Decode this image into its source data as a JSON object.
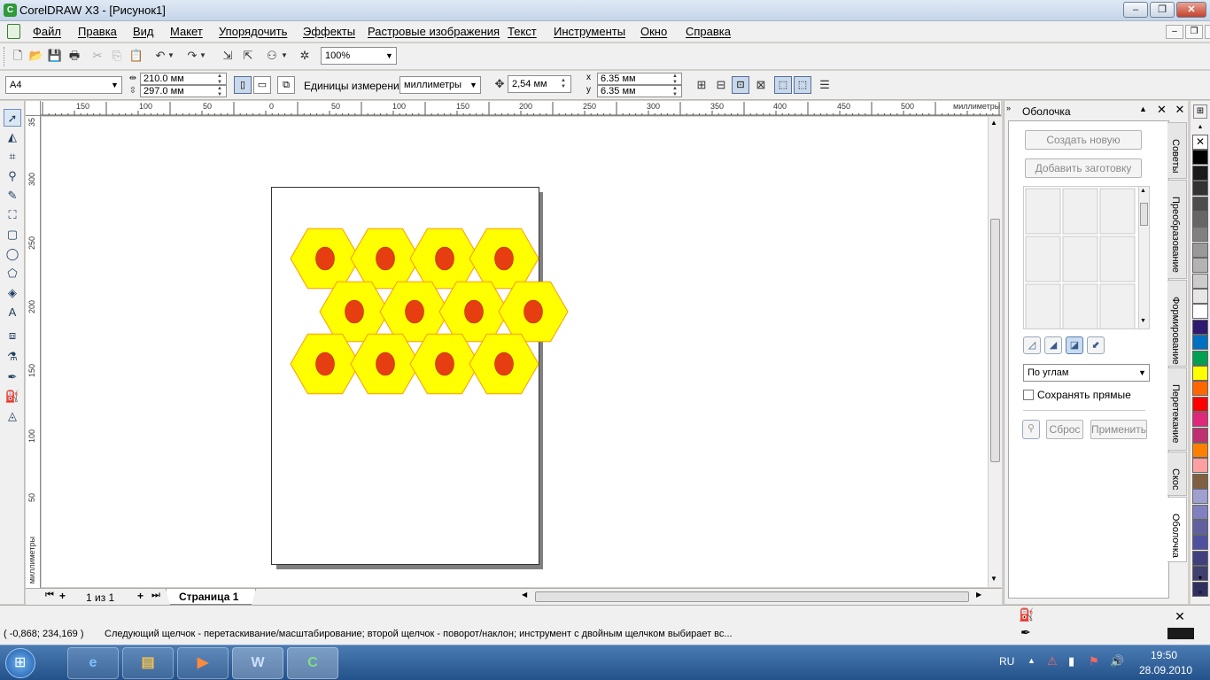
{
  "window": {
    "title": "CorelDRAW X3 - [Рисунок1]",
    "minimize": "–",
    "maximize": "❐",
    "close": "✕"
  },
  "menu": {
    "items": [
      "Файл",
      "Правка",
      "Вид",
      "Макет",
      "Упорядочить",
      "Эффекты",
      "Растровые изображения",
      "Текст",
      "Инструменты",
      "Окно",
      "Справка"
    ]
  },
  "toolbar": {
    "zoom": "100%"
  },
  "properties": {
    "page_preset": "A4",
    "width": "210.0 мм",
    "height": "297.0 мм",
    "units_label": "Единицы измерения:",
    "units_value": "миллиметры",
    "nudge": "2,54 мм",
    "dup_x_label": "x",
    "dup_x": "6.35 мм",
    "dup_y_label": "y",
    "dup_y": "6.35 мм"
  },
  "ruler": {
    "units_label": "миллиметры",
    "h_ticks": [
      "150",
      "100",
      "50",
      "0",
      "50",
      "100",
      "150",
      "200",
      "250",
      "300",
      "350",
      "400",
      "450",
      "500"
    ],
    "v_ticks": [
      "35",
      "300",
      "250",
      "200",
      "150",
      "100",
      "50"
    ]
  },
  "pages": {
    "counter": "1 из 1",
    "tab": "Страница 1"
  },
  "docker": {
    "title": "Оболочка",
    "create_new": "Создать новую",
    "add_preset": "Добавить заготовку",
    "mode": "По углам",
    "keep_lines": "Сохранять прямые",
    "reset": "Сброс",
    "apply": "Применить"
  },
  "docker_tabs": [
    "Советы",
    "Преобразование",
    "Формирование",
    "Перетекание",
    "Скос",
    "Оболочка"
  ],
  "palette": [
    "#ffffff",
    "#000000",
    "#1a1a1a",
    "#333333",
    "#4d4d4d",
    "#666666",
    "#808080",
    "#999999",
    "#b3b3b3",
    "#cccccc",
    "#e6e6e6",
    "#ffffff",
    "#2e1a6e",
    "#0070c0",
    "#00a050",
    "#ffff00",
    "#ff6600",
    "#ff0000",
    "#e0287a",
    "#c03070",
    "#ff8000",
    "#ffa0a0",
    "#806040",
    "#a0a0d0",
    "#8080c0",
    "#6060a0",
    "#5050a0",
    "#404080",
    "#404070",
    "#303060"
  ],
  "drawing": {
    "hex_fill": "#ffff00",
    "hex_stroke": "#ff9900",
    "dot_fill": "#e63e10"
  },
  "status": {
    "coords": "( -0,868; 234,169 )",
    "message": "Следующий щелчок - перетаскивание/масштабирование; второй щелчок - поворот/наклон; инструмент с двойным щелчком выбирает вс..."
  },
  "taskbar": {
    "lang": "RU",
    "time": "19:50",
    "date": "28.09.2010"
  }
}
